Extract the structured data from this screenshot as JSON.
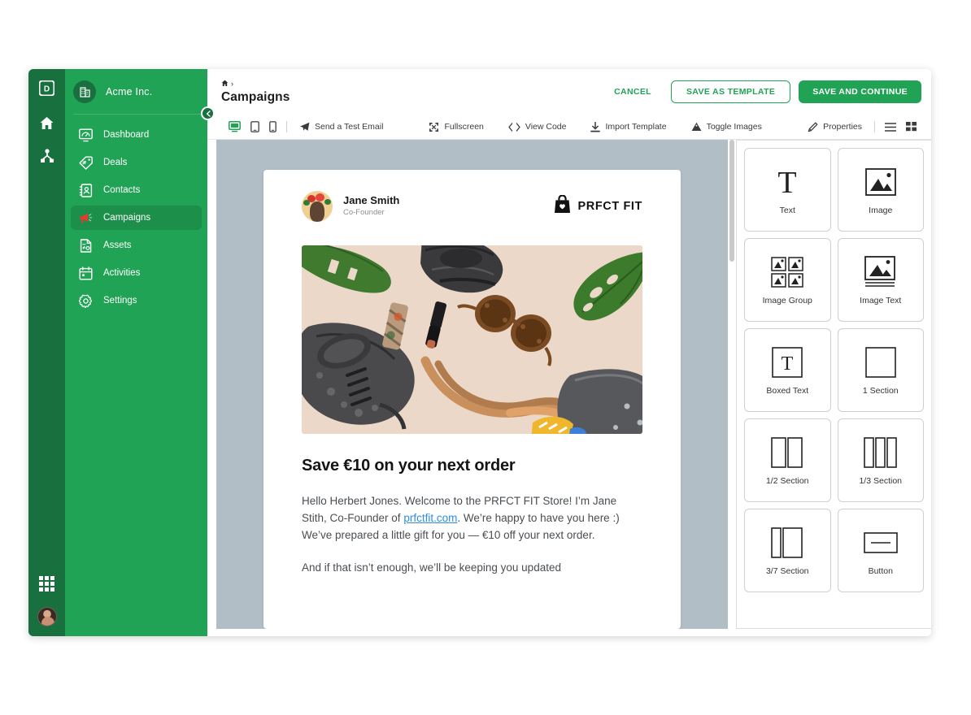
{
  "rail": {
    "logo": "D",
    "icons": [
      {
        "name": "home-icon",
        "label": "Home"
      },
      {
        "name": "hierarchy-icon",
        "label": "Hierarchy"
      }
    ],
    "grid_icon": "apps-grid-icon",
    "avatar": "user-avatar"
  },
  "sidebar": {
    "org_name": "Acme Inc.",
    "org_icon": "building-icon",
    "collapse_icon": "chevron-left-icon",
    "items": [
      {
        "label": "Dashboard",
        "icon": "dashboard-icon",
        "active": false
      },
      {
        "label": "Deals",
        "icon": "deals-tag-icon",
        "active": false
      },
      {
        "label": "Contacts",
        "icon": "contacts-book-icon",
        "active": false
      },
      {
        "label": "Campaigns",
        "icon": "megaphone-icon",
        "active": true
      },
      {
        "label": "Assets",
        "icon": "assets-file-icon",
        "active": false
      },
      {
        "label": "Activities",
        "icon": "calendar-icon",
        "active": false
      },
      {
        "label": "Settings",
        "icon": "gear-icon",
        "active": false
      }
    ]
  },
  "header": {
    "breadcrumb_home_icon": "home-icon",
    "breadcrumb_separator": "›",
    "title": "Campaigns",
    "cancel_label": "CANCEL",
    "save_template_label": "SAVE AS TEMPLATE",
    "save_continue_label": "SAVE AND CONTINUE"
  },
  "toolbar": {
    "devices": [
      {
        "name": "desktop-view-icon",
        "active": true
      },
      {
        "name": "tablet-view-icon",
        "active": false
      },
      {
        "name": "mobile-view-icon",
        "active": false
      }
    ],
    "items": [
      {
        "label": "Send a Test Email",
        "icon": "paper-plane-icon"
      },
      {
        "label": "Fullscreen",
        "icon": "fullscreen-icon"
      },
      {
        "label": "View Code",
        "icon": "code-brackets-icon"
      },
      {
        "label": "Import Template",
        "icon": "download-icon"
      },
      {
        "label": "Toggle Images",
        "icon": "image-toggle-icon"
      },
      {
        "label": "Properties",
        "icon": "pencil-icon"
      }
    ],
    "view_list_icon": "list-view-icon",
    "view_grid_icon": "grid-view-icon"
  },
  "email": {
    "sender_name": "Jane Smith",
    "sender_role": "Co-Founder",
    "sender_avatar": "sender-avatar",
    "brand_icon": "shopping-bag-icon",
    "brand_name": "PRFCT FIT",
    "hero_image_alt": "flat-lay of sneakers, sunglasses, lipstick and leather bag",
    "heading": "Save €10 on your next order",
    "paragraph1_a": "Hello Herbert Jones. Welcome to the PRFCT FIT Store! I’m Jane Stith, Co-Founder of ",
    "paragraph1_link": "prfctfit.com",
    "paragraph1_b": ". We’re happy to have you here :) We’ve prepared  a little gift for you — €10 off your next order.",
    "paragraph2": "And if that isn’t enough, we’ll be keeping you updated"
  },
  "blocks": {
    "items": [
      {
        "label": "Text",
        "icon": "text-block-icon"
      },
      {
        "label": "Image",
        "icon": "image-block-icon"
      },
      {
        "label": "Image Group",
        "icon": "image-group-block-icon"
      },
      {
        "label": "Image Text",
        "icon": "image-text-block-icon"
      },
      {
        "label": "Boxed Text",
        "icon": "boxed-text-block-icon"
      },
      {
        "label": "1 Section",
        "icon": "one-section-block-icon"
      },
      {
        "label": "1/2 Section",
        "icon": "half-section-block-icon"
      },
      {
        "label": "1/3 Section",
        "icon": "third-section-block-icon"
      },
      {
        "label": "3/7 Section",
        "icon": "three-seven-section-block-icon"
      },
      {
        "label": "Button",
        "icon": "button-block-icon"
      }
    ]
  },
  "colors": {
    "brand_green": "#21a355",
    "rail_green": "#18703f",
    "sidebar_green": "#21a355",
    "active_green": "#1c8f4a",
    "canvas_gray": "#b2bec6",
    "link_blue": "#2f8de4"
  }
}
